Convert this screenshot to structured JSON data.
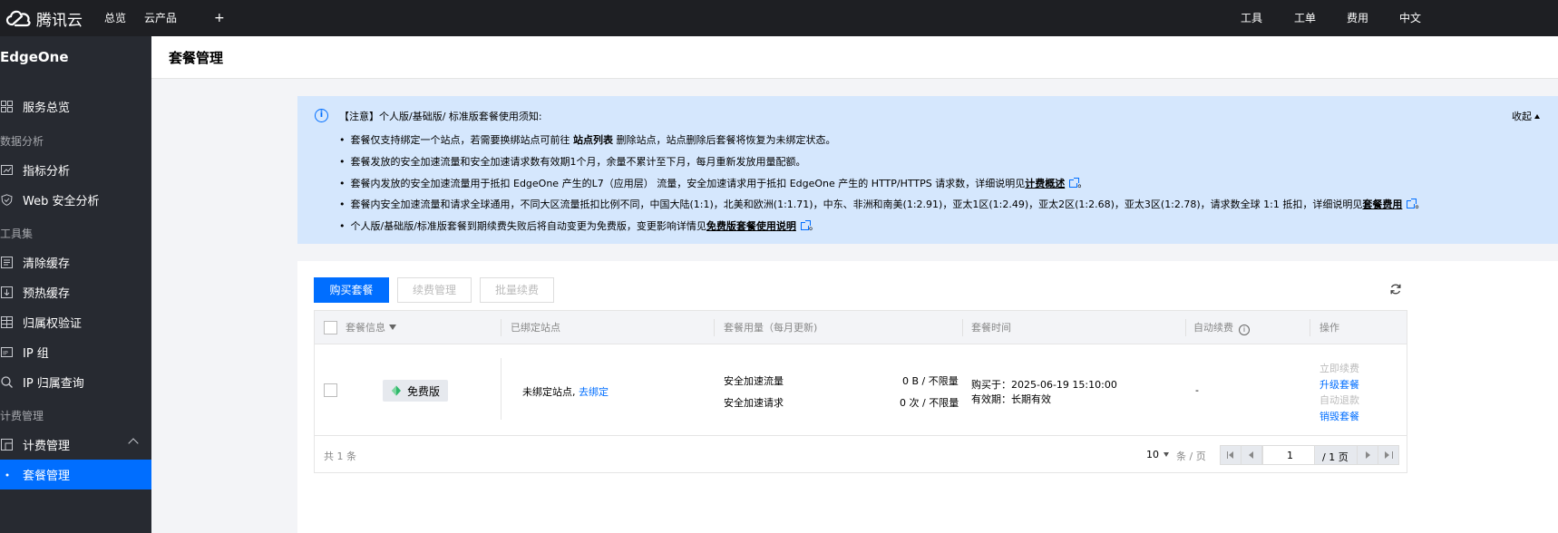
{
  "topbar": {
    "brand": "腾讯云",
    "nav": [
      "总览",
      "云产品"
    ],
    "plus": "+",
    "right": [
      "工具",
      "工单",
      "费用",
      "中文"
    ]
  },
  "sidebar": {
    "product": "EdgeOne",
    "items": [
      {
        "label": "服务总览",
        "icon": "grid-icon"
      },
      {
        "group": "数据分析"
      },
      {
        "label": "指标分析",
        "icon": "chart-icon"
      },
      {
        "label": "Web 安全分析",
        "icon": "shield-icon"
      },
      {
        "group": "工具集"
      },
      {
        "label": "清除缓存",
        "icon": "clear-icon"
      },
      {
        "label": "预热缓存",
        "icon": "download-icon"
      },
      {
        "label": "归属权验证",
        "icon": "verify-icon"
      },
      {
        "label": "IP 组",
        "icon": "ip-icon"
      },
      {
        "label": "IP 归属查询",
        "icon": "search-icon"
      },
      {
        "group": "计费管理"
      },
      {
        "label": "计费管理",
        "icon": "billing-icon"
      },
      {
        "label": "套餐管理",
        "active": true
      }
    ]
  },
  "header": {
    "title": "套餐管理"
  },
  "notice": {
    "head": "【注意】个人版/基础版/ 标准版套餐使用须知:",
    "collapse": "收起",
    "lines": [
      {
        "pre": "套餐仅支持绑定一个站点，若需要换绑站点可前往 ",
        "bold": "站点列表",
        "post": " 删除站点，站点删除后套餐将恢复为未绑定状态。"
      },
      {
        "pre": "套餐发放的安全加速流量和安全加速请求数有效期1个月，余量不累计至下月，每月重新发放用量配额。"
      },
      {
        "pre": "套餐内发放的安全加速流量用于抵扣 EdgeOne 产生的L7（应用层） 流量，安全加速请求用于抵扣 EdgeOne 产生的 HTTP/HTTPS 请求数，详细说明见",
        "link": "计费概述",
        "post": "。"
      },
      {
        "pre": "套餐内安全加速流量和请求全球通用，不同大区流量抵扣比例不同，中国大陆(1:1)，北美和欧洲(1:1.71)，中东、非洲和南美(1:2.91)，亚太1区(1:2.49)，亚太2区(1:2.68)，亚太3区(1:2.78)，请求数全球 1:1 抵扣，详细说明见",
        "link": "套餐费用",
        "post": "。"
      },
      {
        "pre": "个人版/基础版/标准版套餐到期续费失败后将自动变更为免费版，变更影响详情见",
        "link": "免费版套餐使用说明",
        "post": "。"
      }
    ]
  },
  "toolbar": {
    "buy": "购买套餐",
    "renew_mgmt": "续费管理",
    "batch_renew": "批量续费"
  },
  "table": {
    "headers": [
      "套餐信息",
      "已绑定站点",
      "套餐用量（每月更新)",
      "套餐时间",
      "自动续费",
      "操作"
    ],
    "row": {
      "plan": "免费版",
      "site_text": "未绑定站点,",
      "site_link": "去绑定",
      "usage": [
        {
          "label": "安全加速流量",
          "value": "0 B / 不限量"
        },
        {
          "label": "安全加速请求",
          "value": "0 次 / 不限量"
        }
      ],
      "bought": "购买于：2025-06-19 15:10:00",
      "validity": "有效期：长期有效",
      "auto_renew": "-",
      "actions": [
        {
          "label": "立即续费",
          "enabled": false
        },
        {
          "label": "升级套餐",
          "enabled": true
        },
        {
          "label": "自动退款",
          "enabled": false
        },
        {
          "label": "销毁套餐",
          "enabled": true
        }
      ]
    },
    "footer": {
      "total": "共 1 条",
      "page_size": "10",
      "per_page": "条 / 页",
      "page": "1",
      "total_pages": "/ 1 页"
    }
  }
}
